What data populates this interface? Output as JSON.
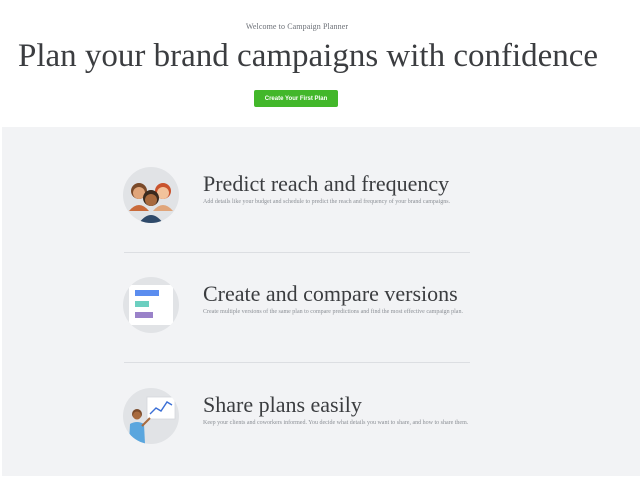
{
  "hero": {
    "welcome": "Welcome to Campaign Planner",
    "headline": "Plan your brand campaigns with confidence",
    "cta_label": "Create Your First Plan"
  },
  "colors": {
    "cta": "#42b72a",
    "features_bg": "#f2f3f5"
  },
  "features": [
    {
      "icon": "people-icon",
      "title": "Predict reach and frequency",
      "description": "Add details like your budget and schedule to predict the reach and frequency of your brand campaigns."
    },
    {
      "icon": "bar-versions-icon",
      "title": "Create and compare versions",
      "description": "Create multiple versions of the same plan to compare predictions and find the most effective campaign plan."
    },
    {
      "icon": "presenter-icon",
      "title": "Share plans easily",
      "description": "Keep your clients and coworkers informed. You decide what details you want to share, and how to share them."
    }
  ]
}
